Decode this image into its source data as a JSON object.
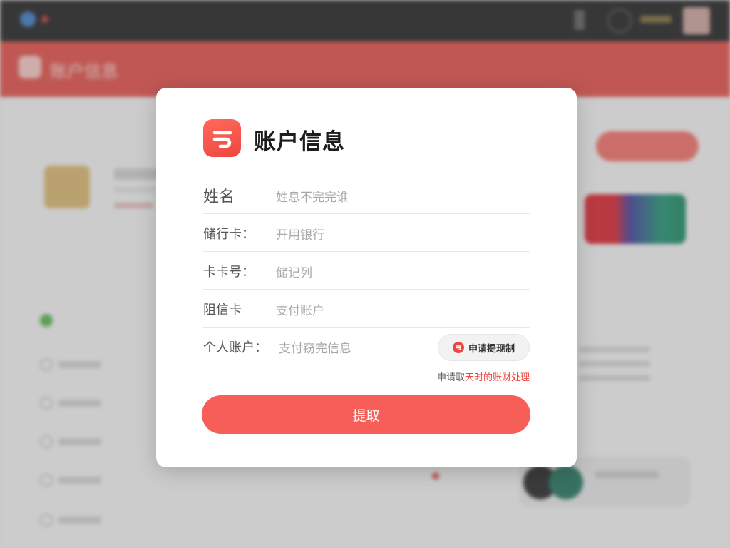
{
  "background": {
    "url_text": "",
    "header_title": "账户信息",
    "gold_label": "",
    "colors": {
      "topbar": "#1c1c1e",
      "brand_red": "#e04a44"
    }
  },
  "dialog": {
    "title": "账户信息",
    "logo_icon": "brand-logo-icon",
    "fields": [
      {
        "label": "姓名",
        "value": "姓息不完完谁"
      },
      {
        "label": "储行卡：",
        "value": "开用银行"
      },
      {
        "label": "卡卡号：",
        "value": "储记列"
      },
      {
        "label": "阻信卡",
        "value": "支付账户"
      },
      {
        "label": "个人账户：",
        "value": "支付窃完信息"
      }
    ],
    "apply_button_label": "申请提现制",
    "hint_prefix": "申请取",
    "hint_highlight": "天时的账财处理",
    "submit_label": "提取",
    "colors": {
      "accent": "#f65e57",
      "text": "#1d1d1f",
      "muted": "#a8a8a8"
    }
  }
}
